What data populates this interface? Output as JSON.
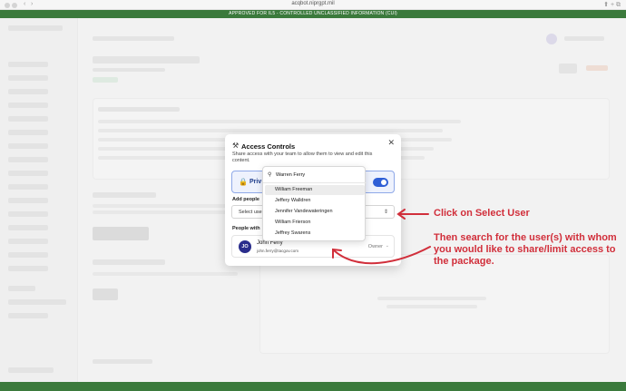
{
  "browser": {
    "url": "acqbot.niprgpt.mil",
    "nav_back": "‹",
    "nav_forward": "›",
    "right_icons": "⬆ + ⧉"
  },
  "banner": {
    "top_text": "APPROVED FOR IL5 - CONTROLLED UNCLASSIFIED INFORMATION (CUI)"
  },
  "modal": {
    "title": "Access Controls",
    "title_icon": "⚒",
    "close": "✕",
    "subtitle": "Share access with your team to allow them to view and edit this content.",
    "private_label": "Priv",
    "private_icon": "🔒",
    "add_people_label": "Add people",
    "select_user_placeholder": "Select use",
    "select_chevron": "⇕",
    "people_with_label": "People with",
    "member": {
      "initials": "JO",
      "name": "John Ferry",
      "email": "john.ferry@tacgov.com",
      "role": "Owner",
      "role_chevron": "⌄"
    }
  },
  "dropdown": {
    "search_value": "Warren Ferry",
    "search_icon": "⚲",
    "options": [
      "William Freeman",
      "Jeffery Walldren",
      "Jennifer Vandewateringen",
      "William Frierson",
      "Jeffrey Swarens"
    ],
    "highlighted_index": 0
  },
  "annotations": {
    "step1": "Click on Select User",
    "step2": "Then search for the user(s) with whom you would like to share/limit access to the package."
  },
  "colors": {
    "annotation_red": "#d12f3b",
    "cui_green": "#3b7a3c",
    "toggle_blue": "#2f5fd6",
    "avatar_navy": "#2a2d8c"
  }
}
